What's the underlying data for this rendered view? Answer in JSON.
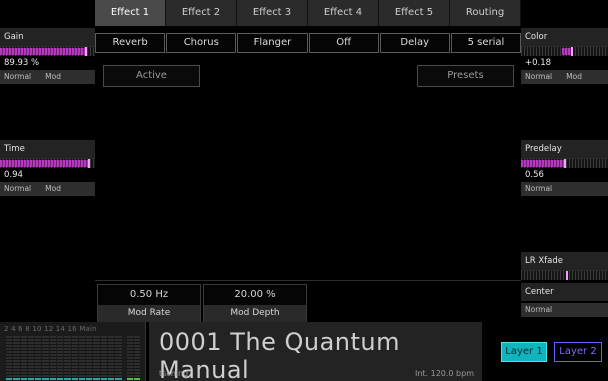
{
  "left_panel": {
    "params": [
      {
        "label": "Gain",
        "value": "89.93 %",
        "level": 0.9,
        "modes": [
          "Normal",
          "Mod"
        ]
      },
      {
        "label": "Time",
        "value": "0.94",
        "level": 0.94,
        "modes": [
          "Normal",
          "Mod"
        ]
      }
    ]
  },
  "right_panel": {
    "params": [
      {
        "label": "Color",
        "value": "+0.18",
        "level": 0.59,
        "modes": [
          "Normal",
          "Mod"
        ]
      },
      {
        "label": "Predelay",
        "value": "0.56",
        "level": 0.5,
        "modes": [
          "Normal"
        ]
      },
      {
        "label": "LR Xfade",
        "level": 0.53
      },
      {
        "label": "Center",
        "modes": [
          "Normal"
        ]
      }
    ]
  },
  "tabs": [
    "Effect 1",
    "Effect 2",
    "Effect 3",
    "Effect 4",
    "Effect 5",
    "Routing"
  ],
  "active_tab": "Effect 1",
  "effect_slots": [
    "Reverb",
    "Chorus",
    "Flanger",
    "Off",
    "Delay",
    "5 serial"
  ],
  "buttons": {
    "active": "Active",
    "presets": "Presets"
  },
  "mod": {
    "rate": {
      "value": "0.50 Hz",
      "label": "Mod Rate"
    },
    "depth": {
      "value": "20.00 %",
      "label": "Mod Depth"
    }
  },
  "meters": {
    "scale": "2   4   6   8  10  12  14  16  Main"
  },
  "patch": {
    "name": "0001 The Quantum Manual",
    "author": "tsching",
    "tempo": "Int. 120.0 bpm"
  },
  "layers": {
    "layer1": "Layer 1",
    "layer2": "Layer 2"
  },
  "colors": {
    "accent_purple": "#b53ac0",
    "layer1": "#0fb4bf",
    "layer2": "#6a5cff"
  }
}
